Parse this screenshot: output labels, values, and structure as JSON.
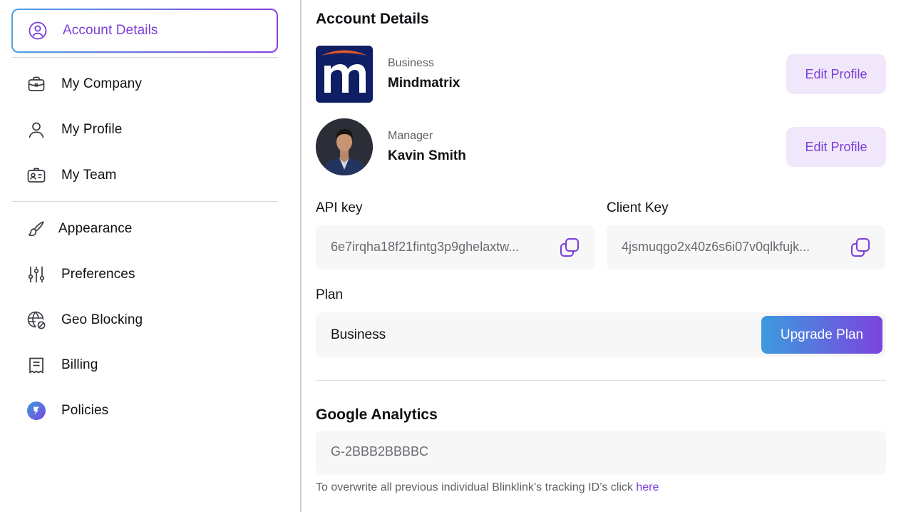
{
  "sidebar": {
    "items": [
      {
        "label": "Account Details",
        "icon": "user-circle-icon",
        "active": true
      },
      {
        "label": "My Company",
        "icon": "briefcase-icon"
      },
      {
        "label": "My Profile",
        "icon": "user-icon"
      },
      {
        "label": "My Team",
        "icon": "id-card-icon"
      },
      {
        "label": "Appearance",
        "icon": "paint-brush-icon"
      },
      {
        "label": "Preferences",
        "icon": "sliders-icon"
      },
      {
        "label": "Geo Blocking",
        "icon": "globe-block-icon"
      },
      {
        "label": "Billing",
        "icon": "receipt-icon"
      },
      {
        "label": "Policies",
        "icon": "shield-badge-icon"
      }
    ]
  },
  "main": {
    "title": "Account Details",
    "business": {
      "role": "Business",
      "name": "Mindmatrix",
      "edit_label": "Edit Profile"
    },
    "manager": {
      "role": "Manager",
      "name": "Kavin Smith",
      "edit_label": "Edit Profile"
    },
    "api_key": {
      "label": "API key",
      "value": "6e7irqha18f21fintg3p9ghelaxtw..."
    },
    "client_key": {
      "label": "Client Key",
      "value": "4jsmuqgo2x40z6s6i07v0qlkfujk..."
    },
    "plan": {
      "label": "Plan",
      "value": "Business",
      "upgrade_label": "Upgrade Plan"
    },
    "google_analytics": {
      "title": "Google Analytics",
      "placeholder": "G-2BBB2BBBBC",
      "note_text": "To overwrite all previous individual Blinklink’s tracking ID’s click ",
      "note_link": "here"
    }
  },
  "colors": {
    "accent": "#7a3fd6",
    "gradient_start": "#3c9bde",
    "gradient_end": "#7c44de",
    "edit_button_bg": "#f1e7fb",
    "field_bg": "#f7f7f8",
    "logo_bg": "#0f1f66"
  }
}
